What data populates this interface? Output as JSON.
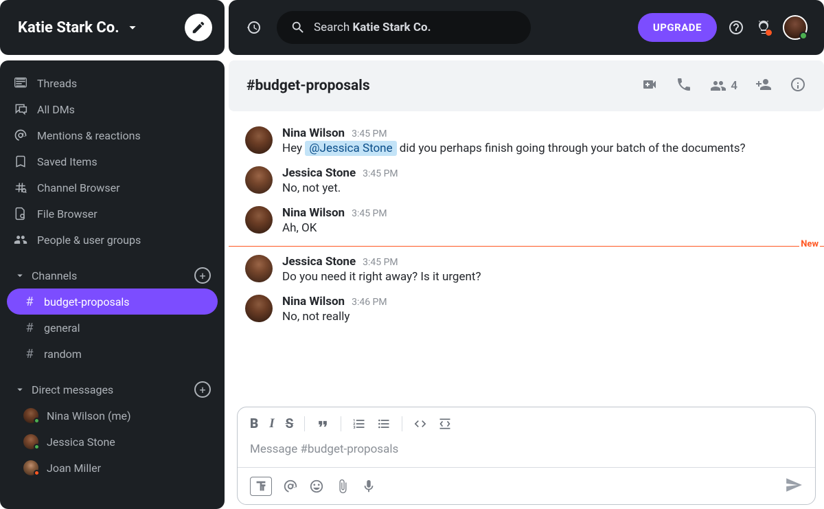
{
  "workspace_name": "Katie Stark Co.",
  "sidebar": {
    "nav": [
      {
        "icon": "threads",
        "label": "Threads"
      },
      {
        "icon": "dms",
        "label": "All DMs"
      },
      {
        "icon": "mentions",
        "label": "Mentions & reactions"
      },
      {
        "icon": "saved",
        "label": "Saved Items"
      },
      {
        "icon": "chbrowser",
        "label": "Channel Browser"
      },
      {
        "icon": "filebrowser",
        "label": "File Browser"
      },
      {
        "icon": "people",
        "label": "People & user groups"
      }
    ],
    "channels_header": "Channels",
    "channels": [
      {
        "name": "budget-proposals",
        "active": true
      },
      {
        "name": "general",
        "active": false
      },
      {
        "name": "random",
        "active": false
      }
    ],
    "dm_header": "Direct messages",
    "dms": [
      {
        "name": "Nina Wilson (me)",
        "avatar": "nina",
        "status": "green"
      },
      {
        "name": "Jessica Stone",
        "avatar": "jess",
        "status": "green"
      },
      {
        "name": "Joan Miller",
        "avatar": "joan",
        "status": "red"
      }
    ]
  },
  "topbar": {
    "search_prefix": "Search ",
    "search_scope": "Katie Stark Co.",
    "upgrade_label": "UPGRADE"
  },
  "channel_header": {
    "name": "#budget-proposals",
    "people_count": "4"
  },
  "messages": [
    {
      "author": "Nina Wilson",
      "time": "3:45 PM",
      "avatar": "nina",
      "text_parts": [
        {
          "t": "Hey "
        },
        {
          "mention": "@Jessica Stone"
        },
        {
          "t": " did you perhaps finish going through your batch of the documents?"
        }
      ]
    },
    {
      "author": "Jessica Stone",
      "time": "3:45 PM",
      "avatar": "jess",
      "text_parts": [
        {
          "t": "No, not yet."
        }
      ]
    },
    {
      "author": "Nina Wilson",
      "time": "3:45 PM",
      "avatar": "nina",
      "text_parts": [
        {
          "t": "Ah, OK"
        }
      ]
    },
    {
      "divider": "New"
    },
    {
      "author": "Jessica Stone",
      "time": "3:45 PM",
      "avatar": "jess",
      "text_parts": [
        {
          "t": "Do you need it right away? Is it urgent?"
        }
      ]
    },
    {
      "author": "Nina Wilson",
      "time": "3:46 PM",
      "avatar": "nina",
      "text_parts": [
        {
          "t": "No, not really"
        }
      ]
    }
  ],
  "composer": {
    "placeholder": "Message #budget-proposals"
  },
  "colors": {
    "accent": "#7c4dff",
    "new": "#ff5722",
    "online": "#4caf50"
  }
}
